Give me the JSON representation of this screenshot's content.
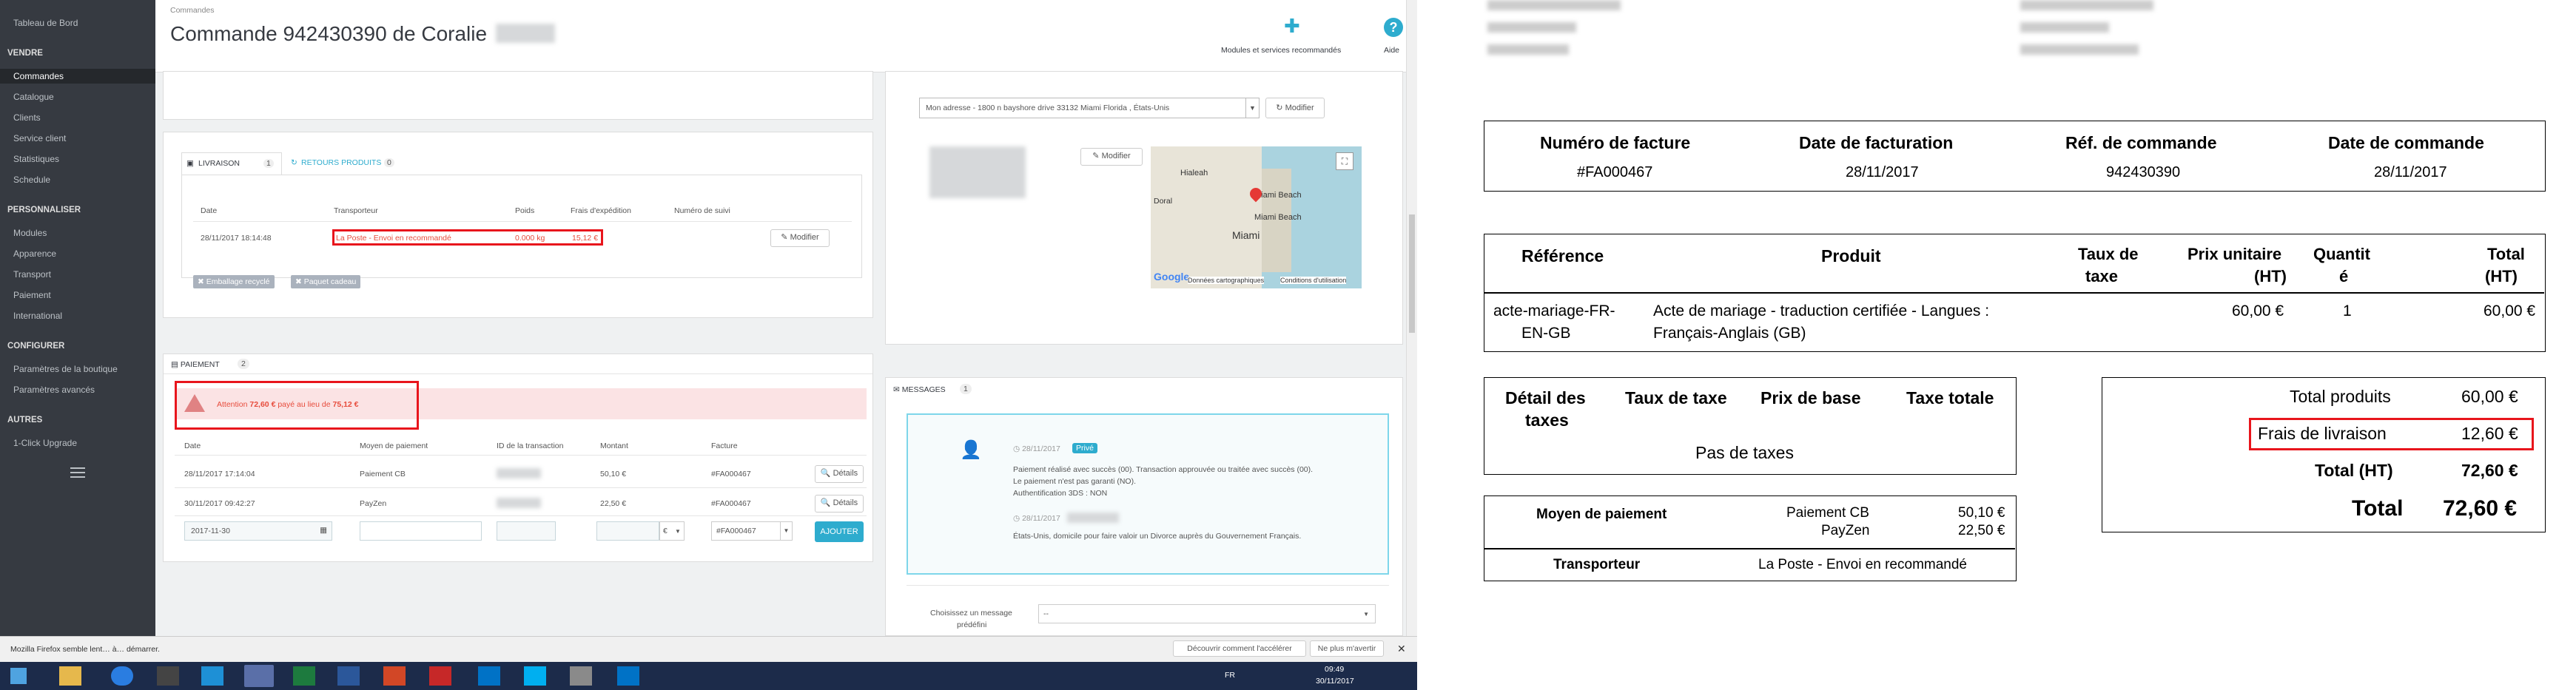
{
  "sidebar": {
    "dashboard": "Tableau de Bord",
    "sections": [
      {
        "title": "VENDRE",
        "items": [
          "Commandes",
          "Catalogue",
          "Clients",
          "Service client",
          "Statistiques",
          "Schedule"
        ]
      },
      {
        "title": "PERSONNALISER",
        "items": [
          "Modules",
          "Apparence",
          "Transport",
          "Paiement",
          "International"
        ]
      },
      {
        "title": "CONFIGURER",
        "items": [
          "Paramètres de la boutique",
          "Paramètres avancés"
        ]
      },
      {
        "title": "AUTRES",
        "items": [
          "1-Click Upgrade"
        ]
      }
    ]
  },
  "header": {
    "breadcrumb": "Commandes",
    "title": "Commande 942430390 de Coralie",
    "modules_label": "Modules et services recommandés",
    "help_label": "Aide"
  },
  "shipping": {
    "tab_label": "LIVRAISON",
    "tab_count": "1",
    "returns_label": "RETOURS PRODUITS",
    "returns_count": "0",
    "columns": [
      "Date",
      "Transporteur",
      "Poids",
      "Frais d'expédition",
      "Numéro de suivi"
    ],
    "row": {
      "date": "28/11/2017 18:14:48",
      "carrier": "La Poste - Envoi en recommandé",
      "weight": "0.000 kg",
      "fee": "15,12 €"
    },
    "edit_label": "Modifier",
    "tag_recycled": "Emballage recyclé",
    "tag_gift": "Paquet cadeau"
  },
  "address": {
    "select_value": "Mon adresse - 1800 n bayshore drive 33132 Miami Florida , États-Unis",
    "modify_label": "Modifier",
    "modify_label2": "Modifier",
    "map_labels": [
      "Hialeah",
      "Miami Beach",
      "Miami",
      "Doral"
    ],
    "map_footer": [
      "Données cartographiques",
      "Conditions d'utilisation"
    ],
    "google": "Google"
  },
  "payment": {
    "title": "PAIEMENT",
    "count": "2",
    "warning_prefix": "Attention ",
    "warning_paid": "72,60 €",
    "warning_mid": " payé au lieu de ",
    "warning_due": "75,12 €",
    "columns": [
      "Date",
      "Moyen de paiement",
      "ID de la transaction",
      "Montant",
      "Facture"
    ],
    "rows": [
      {
        "date": "28/11/2017 17:14:04",
        "method": "Paiement CB",
        "amount": "50,10 €",
        "invoice": "#FA000467",
        "action": "Détails"
      },
      {
        "date": "30/11/2017 09:42:27",
        "method": "PayZen",
        "amount": "22,50 €",
        "invoice": "#FA000467",
        "action": "Détails"
      }
    ],
    "new_date": "2017-11-30",
    "currency": "€",
    "invoice_select": "#FA000467",
    "add_label": "AJOUTER"
  },
  "messages": {
    "title": "MESSAGES",
    "count": "1",
    "date1": "28/11/2017",
    "private": "Privé",
    "body": [
      "Paiement réalisé avec succès (00). Transaction approuvée ou traitée avec succès (00).",
      "Le paiement n'est pas garanti (NO).",
      "Authentification 3DS : NON"
    ],
    "date2": "28/11/2017",
    "body2": "États-Unis, domicile pour faire valoir un Divorce auprès du Gouvernement Français.",
    "choose_label1": "Choisissez un message",
    "choose_label2": "prédéfini",
    "choose_value": "--"
  },
  "notif": {
    "text": "Mozilla Firefox semble lent… à… démarrer.",
    "btn1": "Découvrir comment l'accélérer",
    "btn2": "Ne plus m'avertir"
  },
  "taskbar": {
    "lang": "FR",
    "time": "09:49",
    "date": "30/11/2017"
  },
  "invoice": {
    "header_cols": [
      "Numéro de facture",
      "Date de facturation",
      "Réf. de commande",
      "Date de commande"
    ],
    "header_vals": [
      "#FA000467",
      "28/11/2017",
      "942430390",
      "28/11/2017"
    ],
    "prod_cols": [
      "Référence",
      "Produit",
      "Taux de",
      "taxe",
      "Prix unitaire",
      "(HT)",
      "Quantit",
      "é",
      "Total",
      "(HT)"
    ],
    "prod_ref": [
      "acte-mariage-FR-",
      "EN-GB"
    ],
    "prod_name": [
      "Acte de mariage - traduction certifiée - Langues :",
      "Français-Anglais (GB)"
    ],
    "prod_unit": "60,00 €",
    "prod_qty": "1",
    "prod_total": "60,00 €",
    "tax_cols": [
      "Détail des",
      "taxes",
      "Taux de taxe",
      "Prix de base",
      "Taxe totale"
    ],
    "no_tax": "Pas de taxes",
    "pay_label": "Moyen de paiement",
    "pay_methods": [
      "Paiement CB",
      "PayZen"
    ],
    "pay_amounts": [
      "50,10 €",
      "22,50 €"
    ],
    "carrier_label": "Transporteur",
    "carrier_value": "La Poste - Envoi en recommandé",
    "totals": [
      {
        "label": "Total produits",
        "value": "60,00 €"
      },
      {
        "label": "Frais de livraison",
        "value": "12,60 €"
      },
      {
        "label": "Total (HT)",
        "value": "72,60 €"
      },
      {
        "label": "Total",
        "value": "72,60 €"
      }
    ]
  }
}
